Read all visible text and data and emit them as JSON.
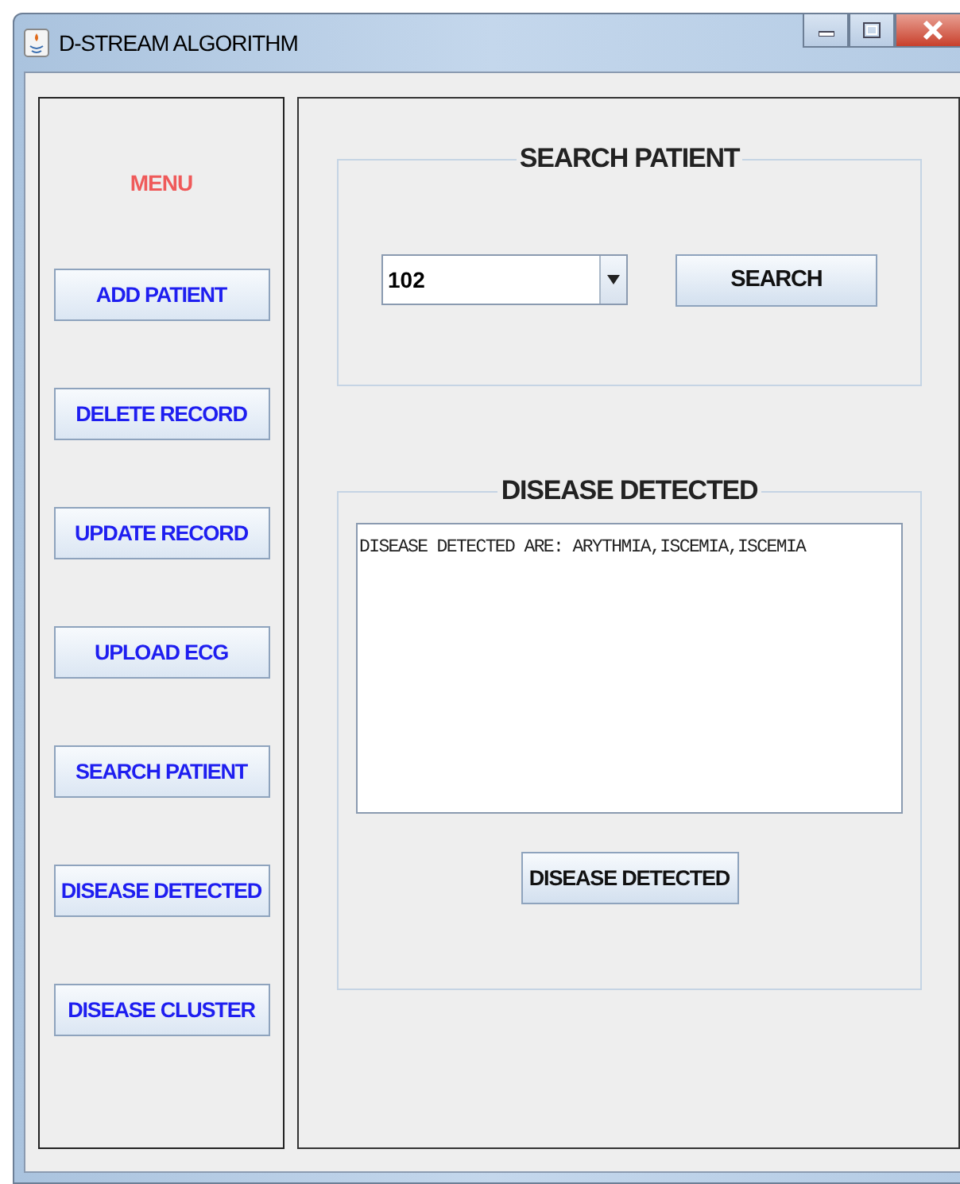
{
  "window": {
    "title": "D-STREAM ALGORITHM"
  },
  "menu": {
    "title": "MENU",
    "buttons": [
      "ADD PATIENT",
      "DELETE RECORD",
      "UPDATE RECORD",
      "UPLOAD ECG",
      "SEARCH PATIENT",
      "DISEASE DETECTED",
      "DISEASE CLUSTER"
    ]
  },
  "search_panel": {
    "title": "SEARCH PATIENT",
    "patient_select": {
      "value": "102"
    },
    "button": "SEARCH"
  },
  "disease_panel": {
    "title": "DISEASE DETECTED",
    "result_text": "DISEASE DETECTED ARE: ARYTHMIA,ISCEMIA,ISCEMIA",
    "button": "DISEASE DETECTED"
  }
}
